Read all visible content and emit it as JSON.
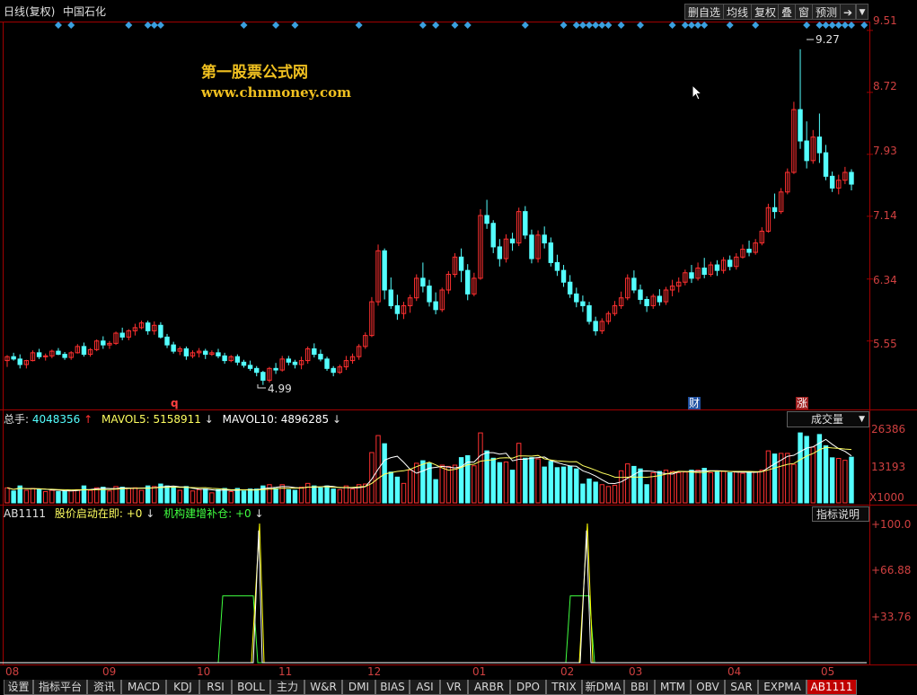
{
  "header": {
    "period": "日线(复权)",
    "stock_name": "中国石化",
    "buttons": [
      "删自选",
      "均线",
      "复权",
      "叠",
      "窗",
      "预测"
    ]
  },
  "watermark": {
    "line1": "第一股票公式网",
    "line2": "www.chnmoney.com"
  },
  "price_axis": [
    "9.51",
    "8.72",
    "7.93",
    "7.14",
    "6.34",
    "5.55"
  ],
  "annotations": {
    "high": "9.27",
    "low": "4.99",
    "event_q": "q",
    "event_cai": "财",
    "event_zhang": "涨"
  },
  "volume_panel": {
    "label": "总手:",
    "value": "4048356",
    "ma5_label": "MAVOL5:",
    "ma5_value": "5158911",
    "ma10_label": "MAVOL10:",
    "ma10_value": "4896285",
    "selector": "成交量",
    "axis": [
      "26386",
      "13193",
      "X1000"
    ]
  },
  "indicator_panel": {
    "name": "AB1111",
    "line1_label": "股价启动在即:",
    "line1_value": "+0",
    "line2_label": "机构建增补仓:",
    "line2_value": "+0",
    "help_button": "指标说明",
    "axis": [
      "+100.0",
      "+66.88",
      "+33.76"
    ]
  },
  "time_axis": [
    "08",
    "09",
    "10",
    "11",
    "12",
    "01",
    "02",
    "03",
    "04",
    "05"
  ],
  "tabs": [
    "设置",
    "指标平台",
    "资讯",
    "MACD",
    "KDJ",
    "RSI",
    "BOLL",
    "主力",
    "W&R",
    "DMI",
    "BIAS",
    "ASI",
    "VR",
    "ARBR",
    "DPO",
    "TRIX",
    "新DMA",
    "BBI",
    "MTM",
    "OBV",
    "SAR",
    "EXPMA",
    "AB1111"
  ],
  "active_tab": "AB1111",
  "colors": {
    "up": "#ff3030",
    "down": "#54ffff",
    "signal": "#3aa0e0",
    "indicator_white": "#ffffff",
    "indicator_yellow": "#ffff00",
    "indicator_green": "#40ff40"
  },
  "chart_data": {
    "type": "candlestick",
    "price_range": [
      4.7,
      9.6
    ],
    "ohlc": [
      [
        5.3,
        5.37,
        5.22,
        5.35
      ],
      [
        5.35,
        5.4,
        5.3,
        5.32
      ],
      [
        5.32,
        5.38,
        5.2,
        5.25
      ],
      [
        5.25,
        5.31,
        5.2,
        5.3
      ],
      [
        5.3,
        5.43,
        5.29,
        5.4
      ],
      [
        5.4,
        5.45,
        5.32,
        5.35
      ],
      [
        5.35,
        5.39,
        5.3,
        5.36
      ],
      [
        5.36,
        5.44,
        5.33,
        5.42
      ],
      [
        5.42,
        5.46,
        5.37,
        5.38
      ],
      [
        5.38,
        5.41,
        5.31,
        5.34
      ],
      [
        5.34,
        5.42,
        5.31,
        5.4
      ],
      [
        5.4,
        5.51,
        5.39,
        5.48
      ],
      [
        5.48,
        5.53,
        5.35,
        5.38
      ],
      [
        5.38,
        5.46,
        5.35,
        5.44
      ],
      [
        5.44,
        5.57,
        5.42,
        5.55
      ],
      [
        5.55,
        5.61,
        5.45,
        5.5
      ],
      [
        5.5,
        5.55,
        5.45,
        5.52
      ],
      [
        5.52,
        5.67,
        5.5,
        5.65
      ],
      [
        5.65,
        5.72,
        5.56,
        5.6
      ],
      [
        5.6,
        5.7,
        5.56,
        5.68
      ],
      [
        5.68,
        5.77,
        5.62,
        5.72
      ],
      [
        5.72,
        5.81,
        5.7,
        5.78
      ],
      [
        5.78,
        5.81,
        5.63,
        5.68
      ],
      [
        5.68,
        5.8,
        5.63,
        5.75
      ],
      [
        5.75,
        5.79,
        5.58,
        5.6
      ],
      [
        5.6,
        5.64,
        5.46,
        5.5
      ],
      [
        5.5,
        5.54,
        5.39,
        5.42
      ],
      [
        5.42,
        5.48,
        5.37,
        5.45
      ],
      [
        5.45,
        5.48,
        5.31,
        5.36
      ],
      [
        5.36,
        5.43,
        5.33,
        5.4
      ],
      [
        5.4,
        5.46,
        5.34,
        5.42
      ],
      [
        5.42,
        5.45,
        5.32,
        5.38
      ],
      [
        5.38,
        5.43,
        5.36,
        5.4
      ],
      [
        5.4,
        5.45,
        5.33,
        5.36
      ],
      [
        5.36,
        5.4,
        5.26,
        5.3
      ],
      [
        5.3,
        5.37,
        5.28,
        5.35
      ],
      [
        5.35,
        5.38,
        5.24,
        5.28
      ],
      [
        5.28,
        5.31,
        5.21,
        5.24
      ],
      [
        5.24,
        5.3,
        5.17,
        5.2
      ],
      [
        5.2,
        5.23,
        5.1,
        5.15
      ],
      [
        5.15,
        5.17,
        4.99,
        5.05
      ],
      [
        5.05,
        5.22,
        5.02,
        5.2
      ],
      [
        5.2,
        5.27,
        5.13,
        5.18
      ],
      [
        5.18,
        5.36,
        5.16,
        5.32
      ],
      [
        5.32,
        5.36,
        5.24,
        5.28
      ],
      [
        5.28,
        5.31,
        5.2,
        5.25
      ],
      [
        5.25,
        5.35,
        5.19,
        5.3
      ],
      [
        5.3,
        5.48,
        5.26,
        5.45
      ],
      [
        5.45,
        5.52,
        5.34,
        5.38
      ],
      [
        5.38,
        5.44,
        5.29,
        5.32
      ],
      [
        5.32,
        5.35,
        5.17,
        5.2
      ],
      [
        5.2,
        5.23,
        5.1,
        5.15
      ],
      [
        5.15,
        5.25,
        5.13,
        5.22
      ],
      [
        5.22,
        5.36,
        5.18,
        5.3
      ],
      [
        5.3,
        5.39,
        5.26,
        5.35
      ],
      [
        5.35,
        5.51,
        5.31,
        5.48
      ],
      [
        5.48,
        5.66,
        5.45,
        5.62
      ],
      [
        5.62,
        6.11,
        5.6,
        6.05
      ],
      [
        6.05,
        6.78,
        6.0,
        6.7
      ],
      [
        6.7,
        6.73,
        6.08,
        6.2
      ],
      [
        6.2,
        6.36,
        5.96,
        6.0
      ],
      [
        6.0,
        6.14,
        5.82,
        5.9
      ],
      [
        5.9,
        6.05,
        5.83,
        6.0
      ],
      [
        6.0,
        6.14,
        5.91,
        6.1
      ],
      [
        6.1,
        6.4,
        6.06,
        6.35
      ],
      [
        6.35,
        6.55,
        6.17,
        6.25
      ],
      [
        6.25,
        6.33,
        5.99,
        6.05
      ],
      [
        6.05,
        6.17,
        5.89,
        5.95
      ],
      [
        5.95,
        6.23,
        5.92,
        6.2
      ],
      [
        6.2,
        6.44,
        6.15,
        6.4
      ],
      [
        6.4,
        6.67,
        6.36,
        6.62
      ],
      [
        6.62,
        6.73,
        6.3,
        6.45
      ],
      [
        6.45,
        6.53,
        6.07,
        6.15
      ],
      [
        6.15,
        6.42,
        6.12,
        6.35
      ],
      [
        6.35,
        7.23,
        6.33,
        7.15
      ],
      [
        7.15,
        7.35,
        6.98,
        7.05
      ],
      [
        7.05,
        7.09,
        6.67,
        6.75
      ],
      [
        6.75,
        6.85,
        6.5,
        6.6
      ],
      [
        6.6,
        6.91,
        6.55,
        6.85
      ],
      [
        6.85,
        6.93,
        6.7,
        6.8
      ],
      [
        6.8,
        7.25,
        6.76,
        7.2
      ],
      [
        7.2,
        7.27,
        6.85,
        6.9
      ],
      [
        6.9,
        6.97,
        6.54,
        6.6
      ],
      [
        6.6,
        6.96,
        6.55,
        6.9
      ],
      [
        6.9,
        7.01,
        6.73,
        6.8
      ],
      [
        6.8,
        6.87,
        6.5,
        6.55
      ],
      [
        6.55,
        6.65,
        6.38,
        6.45
      ],
      [
        6.45,
        6.52,
        6.24,
        6.3
      ],
      [
        6.3,
        6.39,
        6.1,
        6.15
      ],
      [
        6.15,
        6.23,
        5.98,
        6.05
      ],
      [
        6.05,
        6.13,
        5.92,
        6.0
      ],
      [
        6.0,
        6.05,
        5.76,
        5.8
      ],
      [
        5.8,
        5.86,
        5.62,
        5.68
      ],
      [
        5.68,
        5.84,
        5.64,
        5.8
      ],
      [
        5.8,
        5.93,
        5.76,
        5.9
      ],
      [
        5.9,
        6.06,
        5.87,
        6.0
      ],
      [
        6.0,
        6.18,
        5.96,
        6.1
      ],
      [
        6.1,
        6.4,
        6.07,
        6.35
      ],
      [
        6.35,
        6.45,
        6.16,
        6.2
      ],
      [
        6.2,
        6.27,
        6.02,
        6.08
      ],
      [
        6.08,
        6.12,
        5.92,
        6.0
      ],
      [
        6.0,
        6.15,
        5.96,
        6.12
      ],
      [
        6.12,
        6.21,
        6.0,
        6.05
      ],
      [
        6.05,
        6.24,
        6.01,
        6.2
      ],
      [
        6.2,
        6.33,
        6.12,
        6.25
      ],
      [
        6.25,
        6.36,
        6.17,
        6.3
      ],
      [
        6.3,
        6.46,
        6.26,
        6.42
      ],
      [
        6.42,
        6.52,
        6.29,
        6.35
      ],
      [
        6.35,
        6.55,
        6.32,
        6.48
      ],
      [
        6.48,
        6.61,
        6.35,
        6.4
      ],
      [
        6.4,
        6.56,
        6.37,
        6.52
      ],
      [
        6.52,
        6.58,
        6.38,
        6.45
      ],
      [
        6.45,
        6.62,
        6.41,
        6.58
      ],
      [
        6.58,
        6.64,
        6.45,
        6.5
      ],
      [
        6.5,
        6.67,
        6.46,
        6.62
      ],
      [
        6.62,
        6.78,
        6.6,
        6.72
      ],
      [
        6.72,
        6.83,
        6.63,
        6.68
      ],
      [
        6.68,
        6.85,
        6.65,
        6.8
      ],
      [
        6.8,
        7.0,
        6.77,
        6.95
      ],
      [
        6.95,
        7.3,
        6.93,
        7.25
      ],
      [
        7.25,
        7.43,
        7.11,
        7.2
      ],
      [
        7.2,
        7.5,
        7.17,
        7.45
      ],
      [
        7.45,
        7.75,
        7.42,
        7.7
      ],
      [
        7.7,
        8.6,
        7.68,
        8.5
      ],
      [
        8.5,
        9.27,
        8.0,
        8.1
      ],
      [
        8.1,
        8.35,
        7.75,
        7.85
      ],
      [
        7.85,
        8.24,
        7.81,
        8.15
      ],
      [
        8.15,
        8.45,
        7.82,
        7.95
      ],
      [
        7.95,
        8.05,
        7.6,
        7.65
      ],
      [
        7.65,
        7.71,
        7.45,
        7.5
      ],
      [
        7.5,
        7.67,
        7.42,
        7.6
      ],
      [
        7.6,
        7.77,
        7.55,
        7.7
      ],
      [
        7.7,
        7.74,
        7.47,
        7.55
      ]
    ]
  }
}
